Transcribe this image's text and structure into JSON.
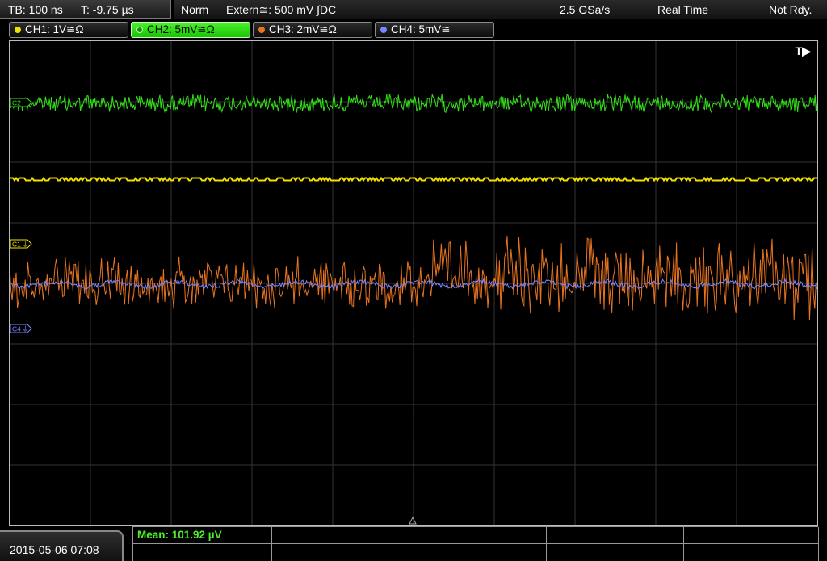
{
  "status": {
    "timebase": "TB: 100 ns",
    "trigger_time": "T: -9.75 µs",
    "mode": "Norm",
    "trigger_source": "Extern≅: 500 mV ∫DC",
    "sample_rate": "2.5 GSa/s",
    "acq_mode": "Real Time",
    "state": "Not Rdy."
  },
  "channels": [
    {
      "label": "CH1: 1V≅Ω",
      "color": "#f0e000",
      "active": false
    },
    {
      "label": "CH2: 5mV≅Ω",
      "color": "#33e018",
      "active": true
    },
    {
      "label": "CH3: 2mV≅Ω",
      "color": "#e9741f",
      "active": false
    },
    {
      "label": "CH4: 5mV≅",
      "color": "#7a86ff",
      "active": false
    }
  ],
  "markers": {
    "c1": "C1",
    "c4": "C4",
    "c2": "C2",
    "trigger": "T▶"
  },
  "measurement": {
    "mean": "Mean: 101.92 µV"
  },
  "datetime": "2015-05-06 07:08"
}
